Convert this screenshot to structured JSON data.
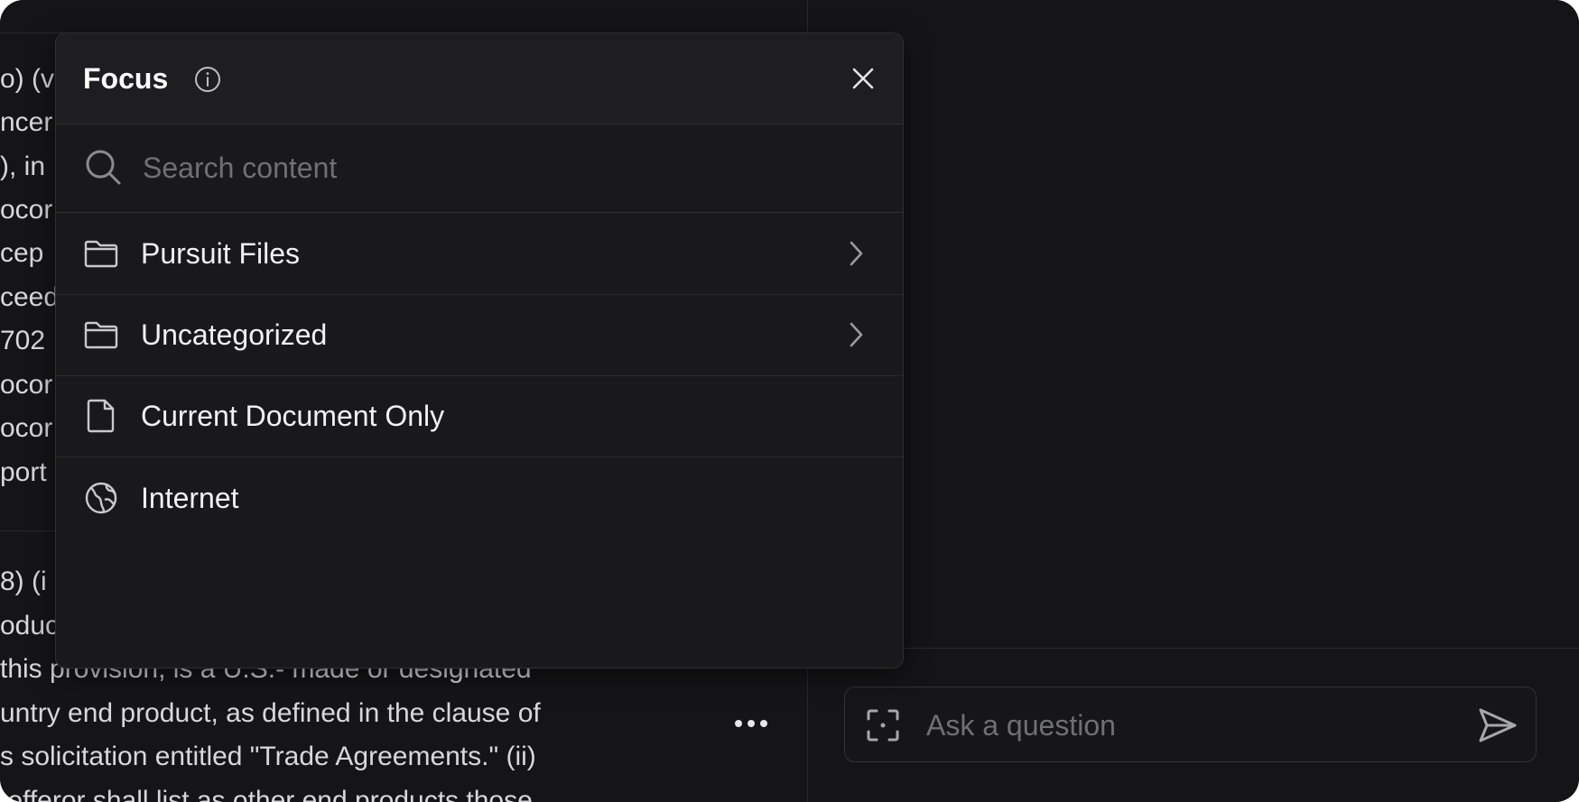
{
  "document": {
    "lines": [
      "o) (v",
      "ncer",
      "), in",
      "ocor",
      "cep",
      "ceed",
      "702",
      "ocor",
      "ocor",
      "port",
      "8) (i",
      "oduc",
      "this provision, is a U.S.- made or designated",
      "untry end product, as defined in the clause of",
      "s solicitation entitled \"Trade Agreements.\" (ii)",
      " offeror shall list as other end products those"
    ]
  },
  "focus_popup": {
    "title": "Focus",
    "search_placeholder": "Search content",
    "items": [
      {
        "label": "Pursuit Files",
        "icon": "folder-icon",
        "has_submenu": true
      },
      {
        "label": "Uncategorized",
        "icon": "folder-icon",
        "has_submenu": true
      },
      {
        "label": "Current Document Only",
        "icon": "document-icon",
        "has_submenu": false
      },
      {
        "label": "Internet",
        "icon": "globe-icon",
        "has_submenu": false
      }
    ]
  },
  "chat": {
    "input_placeholder": "Ask a question"
  },
  "colors": {
    "background": "#151517",
    "popup": "#19191c",
    "text": "#f2f2f4",
    "muted": "#6f6f76"
  }
}
